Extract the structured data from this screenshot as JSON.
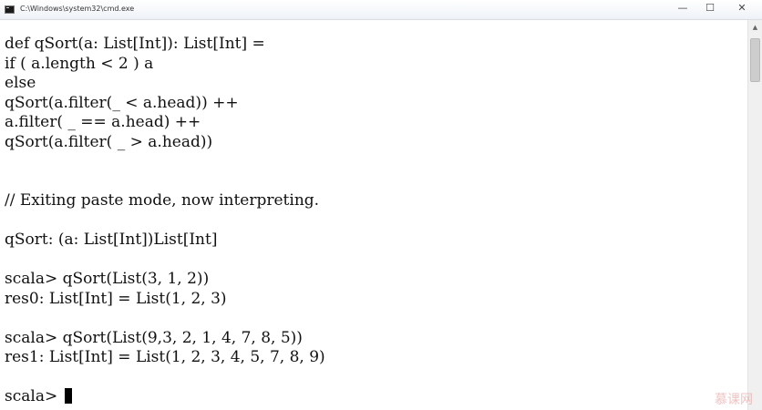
{
  "window": {
    "title": "C:\\Windows\\system32\\cmd.exe",
    "minimize_symbol": "—",
    "maximize_symbol": "☐",
    "close_symbol": "✕"
  },
  "console": {
    "lines": [
      "def qSort(a: List[Int]): List[Int] =",
      "if ( a.length < 2 ) a",
      "else",
      "qSort(a.filter(_ < a.head)) ++",
      "a.filter( _ == a.head) ++",
      "qSort(a.filter( _ > a.head))",
      "",
      "",
      "// Exiting paste mode, now interpreting.",
      "",
      "qSort: (a: List[Int])List[Int]",
      "",
      "scala> qSort(List(3, 1, 2))",
      "res0: List[Int] = List(1, 2, 3)",
      "",
      "scala> qSort(List(9,3, 2, 1, 4, 7, 8, 5))",
      "res1: List[Int] = List(1, 2, 3, 4, 5, 7, 8, 9)",
      "",
      "scala> "
    ]
  },
  "scrollbar": {
    "up_arrow": "▲"
  },
  "watermark": {
    "text": "慕课网"
  }
}
